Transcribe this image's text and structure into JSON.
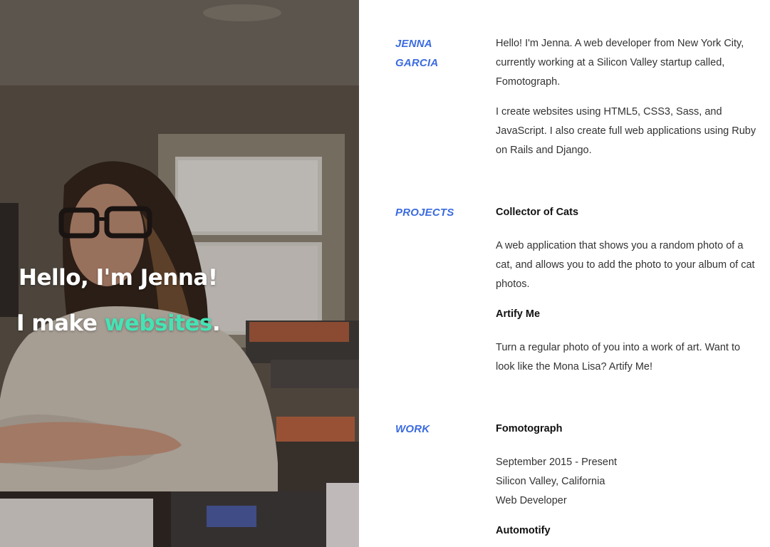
{
  "hero": {
    "greeting": "Hello, I'm Jenna!",
    "tagline_prefix": "I make ",
    "tagline_accent": "websites",
    "tagline_suffix": ".",
    "accent_color": "#45e3b4"
  },
  "about": {
    "label_line1": "JENNA",
    "label_line2": "GARCIA",
    "paragraphs": [
      "Hello! I'm Jenna. A web developer from New York City, currently working at a Silicon Valley startup called, Fomotograph.",
      "I create websites using HTML5, CSS3, Sass, and JavaScript. I also create full web applications using Ruby on Rails and Django."
    ]
  },
  "projects": {
    "label": "PROJECTS",
    "items": [
      {
        "title": "Collector of Cats",
        "description": "A web application that shows you a random photo of a cat, and allows you to add the photo to your album of cat photos."
      },
      {
        "title": "Artify Me",
        "description": "Turn a regular photo of you into a work of art. Want to look like the Mona Lisa? Artify Me!"
      }
    ]
  },
  "work": {
    "label": "WORK",
    "items": [
      {
        "title": "Fomotograph",
        "dates": "September 2015 - Present",
        "location": "Silicon Valley, California",
        "role": "Web Developer"
      },
      {
        "title": "Automotify"
      }
    ]
  },
  "colors": {
    "label_blue": "#3b6be0",
    "text": "#333333",
    "heading": "#111111"
  }
}
